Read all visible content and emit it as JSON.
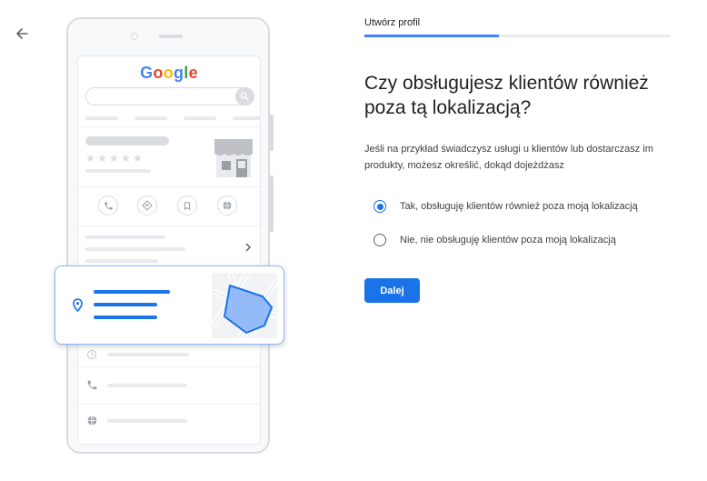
{
  "header": {
    "step_label": "Utwórz profil",
    "progress_percent": 44
  },
  "illustration": {
    "logo": {
      "letters": [
        {
          "char": "G",
          "color": "#4285F4"
        },
        {
          "char": "o",
          "color": "#EA4335"
        },
        {
          "char": "o",
          "color": "#FBBC05"
        },
        {
          "char": "g",
          "color": "#4285F4"
        },
        {
          "char": "l",
          "color": "#34A853"
        },
        {
          "char": "e",
          "color": "#EA4335"
        }
      ]
    },
    "rating_stars": 5,
    "icons": [
      "phone-icon",
      "directions-icon",
      "bookmark-icon",
      "globe-icon",
      "location-pin-icon",
      "store-icon",
      "map-icon",
      "chevron-right-icon",
      "search-icon"
    ]
  },
  "main": {
    "heading": "Czy obsługujesz klientów również poza tą lokalizacją?",
    "description": "Jeśli na przykład świadczysz usługi u klientów lub dostarczasz im produkty, możesz określić, dokąd dojeżdżasz",
    "options": [
      {
        "label": "Tak, obsługuję klientów również poza moją lokalizacją",
        "selected": true
      },
      {
        "label": "Nie, nie obsługuję klientów poza moją lokalizacją",
        "selected": false
      }
    ],
    "next_label": "Dalej"
  },
  "colors": {
    "accent": "#1a73e8",
    "progress": "#4285f4",
    "map_area": "#8ab4f8"
  }
}
